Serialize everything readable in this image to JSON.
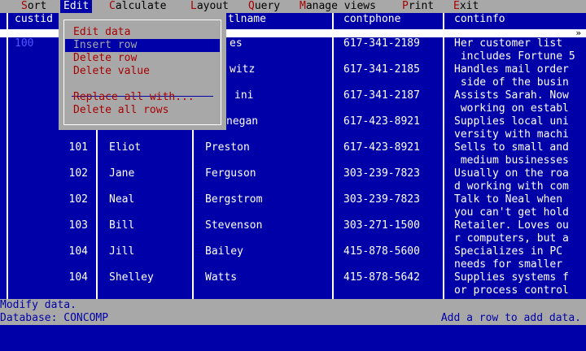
{
  "menubar": {
    "items": [
      {
        "hotkey": "S",
        "rest": "ort"
      },
      {
        "hotkey": "E",
        "rest": "dit"
      },
      {
        "hotkey": "C",
        "rest": "alculate"
      },
      {
        "hotkey": "L",
        "rest": "ayout"
      },
      {
        "hotkey": "Q",
        "rest": "uery"
      },
      {
        "hotkey": "M",
        "rest": "anage views"
      },
      {
        "hotkey": "P",
        "rest": "rint"
      },
      {
        "hotkey": "E",
        "rest": "xit"
      }
    ]
  },
  "edit_menu": {
    "items": [
      {
        "hotkey": "E",
        "rest": "dit data"
      },
      {
        "hotkey": "I",
        "rest": "nsert row"
      },
      {
        "hotkey": "D",
        "rest": "elete row"
      },
      {
        "hotkey": "D",
        "rest": "elete value"
      },
      {
        "hotkey": "R",
        "rest": "eplace all with..."
      },
      {
        "hotkey": "D",
        "rest": "elete all rows"
      }
    ]
  },
  "table": {
    "headers": {
      "custid": "custid",
      "lname_partial": "tlname",
      "contphone": "contphone",
      "continfo": "continfo"
    },
    "scroll_arrow": "»",
    "rows": [
      {
        "custid": "100",
        "fname": "",
        "lname": "es",
        "phone": "617-341-2189",
        "info1": "Her customer list",
        "info2": " includes Fortune 5"
      },
      {
        "custid": "",
        "fname": "",
        "lname": "witz",
        "phone": "617-341-2185",
        "info1": "Handles mail order",
        "info2": " side of the busin"
      },
      {
        "custid": "",
        "fname": "",
        "lname": "ini",
        "phone": "617-341-2187",
        "info1": "Assists Sarah. Now",
        "info2": " working on establ"
      },
      {
        "custid": "",
        "fname": "",
        "lname": "negan",
        "phone": "617-423-8921",
        "info1": "Supplies local uni",
        "info2": "versity with machi"
      },
      {
        "custid": "101",
        "fname": "Eliot",
        "lname": "Preston",
        "phone": "617-423-8921",
        "info1": "Sells to small and",
        "info2": " medium businesses"
      },
      {
        "custid": "102",
        "fname": "Jane",
        "lname": "Ferguson",
        "phone": "303-239-7823",
        "info1": "Usually on the roa",
        "info2": "d working with com"
      },
      {
        "custid": "102",
        "fname": "Neal",
        "lname": "Bergstrom",
        "phone": "303-239-7823",
        "info1": "Talk to Neal when",
        "info2": "you can't get hold"
      },
      {
        "custid": "103",
        "fname": "Bill",
        "lname": "Stevenson",
        "phone": "303-271-1500",
        "info1": "Retailer. Loves ou",
        "info2": "r computers, but a"
      },
      {
        "custid": "104",
        "fname": "Jill",
        "lname": "Bailey",
        "phone": "415-878-5600",
        "info1": "Specializes in PC",
        "info2": "needs for smaller"
      },
      {
        "custid": "104",
        "fname": "Shelley",
        "lname": "Watts",
        "phone": "415-878-5642",
        "info1": "Supplies systems f",
        "info2": "or process control"
      }
    ]
  },
  "status": {
    "line1": "Modify data.",
    "line2_left": "Database: CONCOMP",
    "line2_right": "Add a row to add data."
  },
  "colors": {
    "background": "#0000A8",
    "menubar": "#A8A8A8",
    "hotkey": "#A80000"
  }
}
